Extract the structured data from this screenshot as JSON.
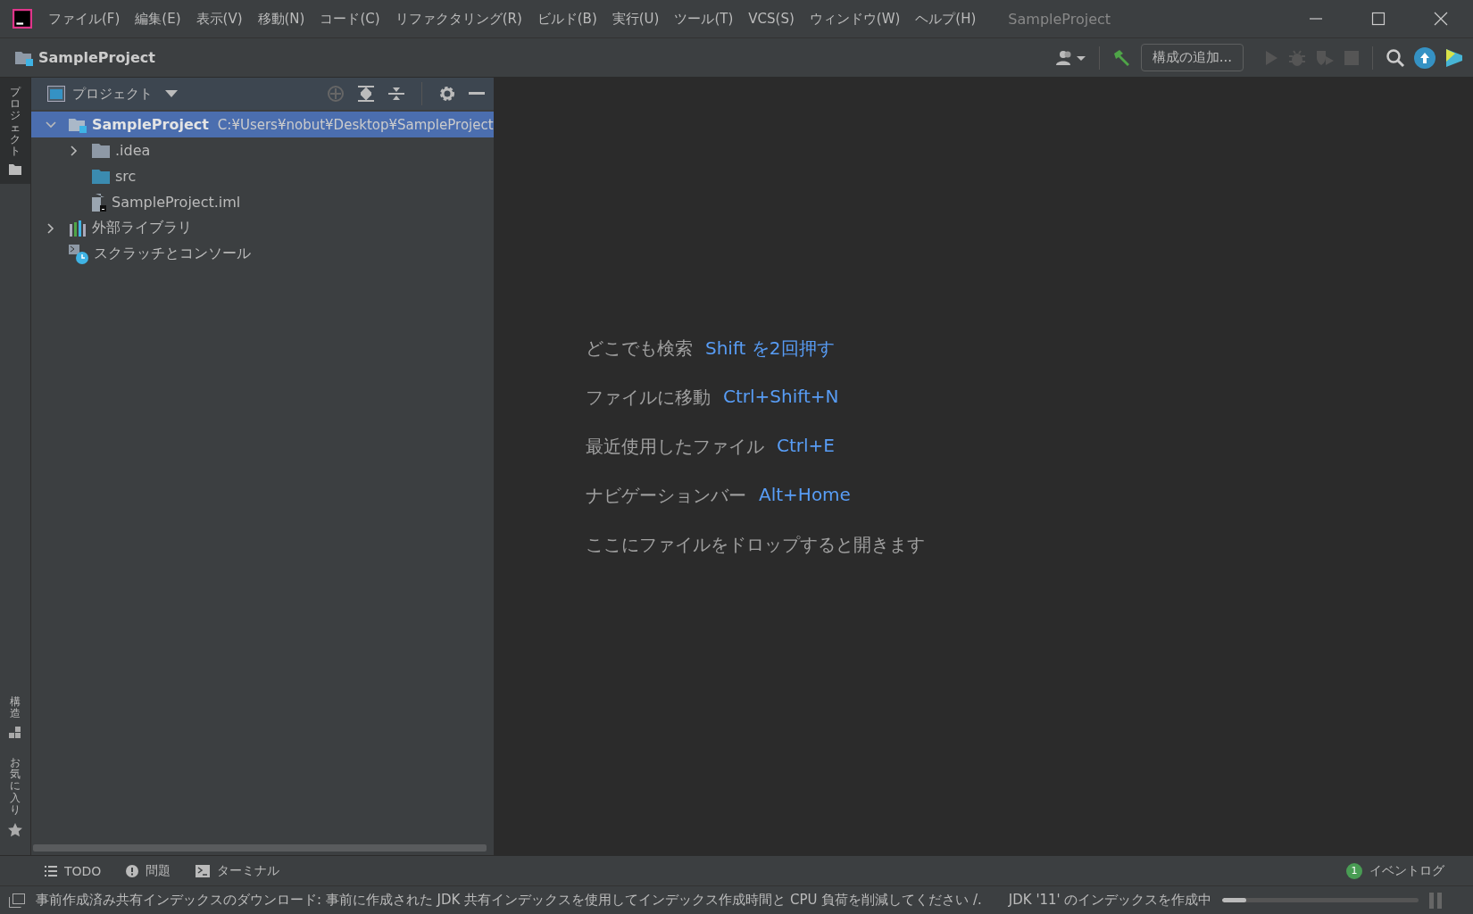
{
  "window": {
    "title": "SampleProject"
  },
  "menu": [
    "ファイル(F)",
    "編集(E)",
    "表示(V)",
    "移動(N)",
    "コード(C)",
    "リファクタリング(R)",
    "ビルド(B)",
    "実行(U)",
    "ツール(T)",
    "VCS(S)",
    "ウィンドウ(W)",
    "ヘルプ(H)"
  ],
  "navbar": {
    "breadcrumb": "SampleProject",
    "config_button": "構成の追加..."
  },
  "left_strip": {
    "top": [
      {
        "label": "プロジェクト",
        "selected": true
      }
    ],
    "bottom": [
      {
        "label": "構造",
        "kind": "structure"
      },
      {
        "label": "お気に入り",
        "kind": "favorites"
      }
    ]
  },
  "project_panel": {
    "title": "プロジェクト",
    "tree": [
      {
        "kind": "project",
        "name": "SampleProject",
        "path": "C:¥Users¥nobut¥Desktop¥SampleProject",
        "expanded": true,
        "selected": true,
        "children": [
          {
            "kind": "folder",
            "name": ".idea",
            "expanded": false,
            "selected": false
          },
          {
            "kind": "source-folder",
            "name": "src",
            "selected": false
          },
          {
            "kind": "module-file",
            "name": "SampleProject.iml",
            "selected": false
          }
        ]
      },
      {
        "kind": "libraries",
        "name": "外部ライブラリ",
        "expanded": false,
        "selected": false
      },
      {
        "kind": "scratches",
        "name": "スクラッチとコンソール",
        "selected": false
      }
    ]
  },
  "editor_hints": [
    {
      "label": "どこでも検索",
      "shortcut": "Shift を2回押す"
    },
    {
      "label": "ファイルに移動",
      "shortcut": "Ctrl+Shift+N"
    },
    {
      "label": "最近使用したファイル",
      "shortcut": "Ctrl+E"
    },
    {
      "label": "ナビゲーションバー",
      "shortcut": "Alt+Home"
    },
    {
      "label": "ここにファイルをドロップすると開きます"
    }
  ],
  "tool_windows": [
    {
      "kind": "todo",
      "label": "TODO"
    },
    {
      "kind": "problems",
      "label": "問題"
    },
    {
      "kind": "terminal",
      "label": "ターミナル"
    }
  ],
  "event_log": {
    "label": "イベントログ",
    "count": "1"
  },
  "status_bar": {
    "message": "事前作成済み共有インデックスのダウンロード: 事前に作成された JDK 共有インデックスを使用してインデックス作成時間と CPU 負荷を削減してください /.",
    "task": "JDK '11' のインデックスを作成中",
    "level": 0.12
  }
}
